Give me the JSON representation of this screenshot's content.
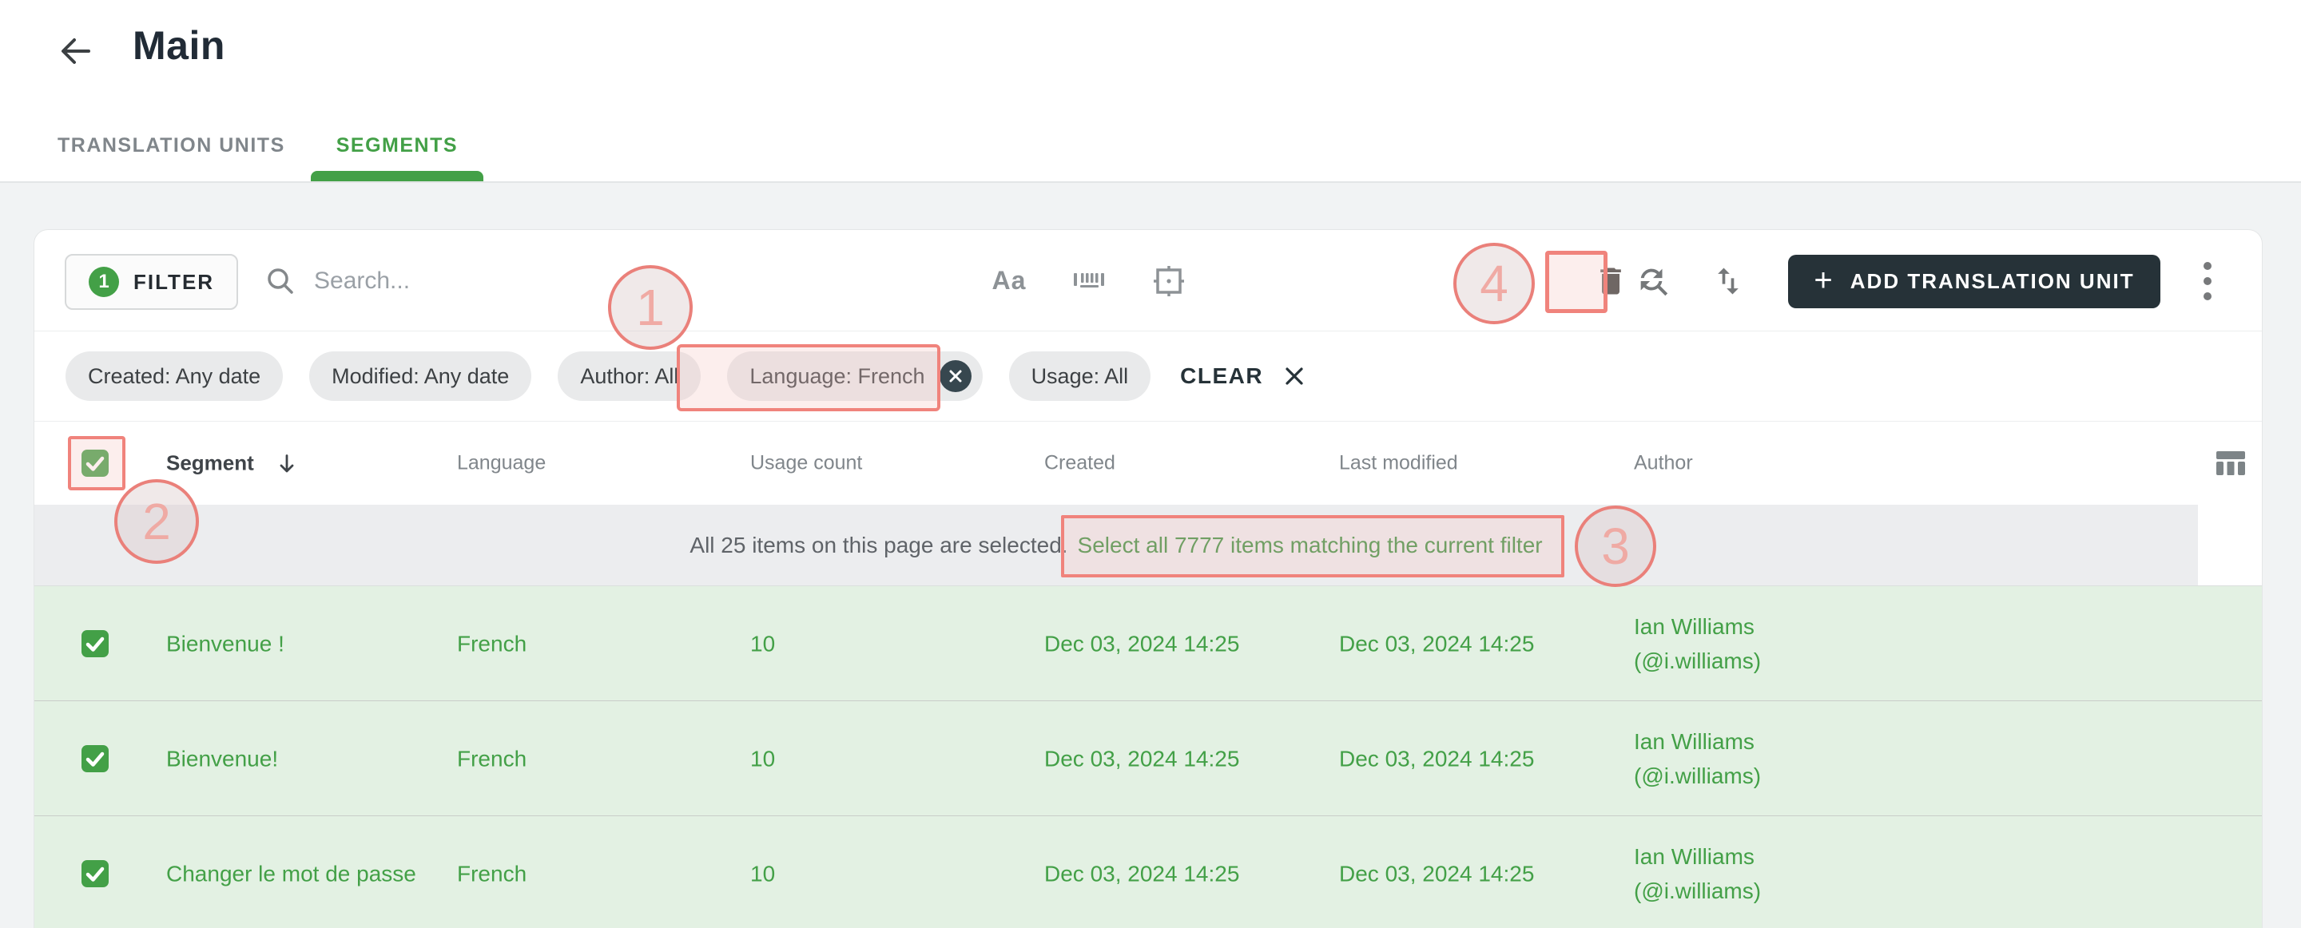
{
  "header": {
    "title": "Main"
  },
  "tabs": {
    "translation_units": "TRANSLATION UNITS",
    "segments": "SEGMENTS"
  },
  "toolbar": {
    "filter_label": "FILTER",
    "filter_count": "1",
    "search_placeholder": "Search...",
    "match_case_label": "Aa",
    "add_button_plus": "+",
    "add_button_label": "ADD TRANSLATION UNIT"
  },
  "filter_chips": {
    "created": "Created: Any date",
    "modified": "Modified: Any date",
    "author": "Author: All",
    "language": "Language: French",
    "usage": "Usage: All",
    "clear_label": "CLEAR"
  },
  "table": {
    "headers": {
      "segment": "Segment",
      "language": "Language",
      "usage_count": "Usage count",
      "created": "Created",
      "last_modified": "Last modified",
      "author": "Author"
    },
    "selection_banner": {
      "prefix": "All 25 items on this page are selected.",
      "link": "Select all 7777 items matching the current filter"
    },
    "rows": [
      {
        "segment": "Bienvenue !",
        "language": "French",
        "usage_count": "10",
        "created": "Dec 03, 2024 14:25",
        "last_modified": "Dec 03, 2024 14:25",
        "author_name": "Ian Williams",
        "author_handle": "(@i.williams)"
      },
      {
        "segment": "Bienvenue!",
        "language": "French",
        "usage_count": "10",
        "created": "Dec 03, 2024 14:25",
        "last_modified": "Dec 03, 2024 14:25",
        "author_name": "Ian Williams",
        "author_handle": "(@i.williams)"
      },
      {
        "segment": "Changer le mot de passe",
        "language": "French",
        "usage_count": "10",
        "created": "Dec 03, 2024 14:25",
        "last_modified": "Dec 03, 2024 14:25",
        "author_name": "Ian Williams",
        "author_handle": "(@i.williams)"
      }
    ]
  },
  "annotations": {
    "step1": "1",
    "step2": "2",
    "step3": "3",
    "step4": "4"
  },
  "colors": {
    "accent_green": "#43a047",
    "dark_button": "#263238",
    "annotation_red": "#ea807a",
    "selected_row_bg": "#e3f1e3",
    "banner_bg": "#ecedef"
  }
}
